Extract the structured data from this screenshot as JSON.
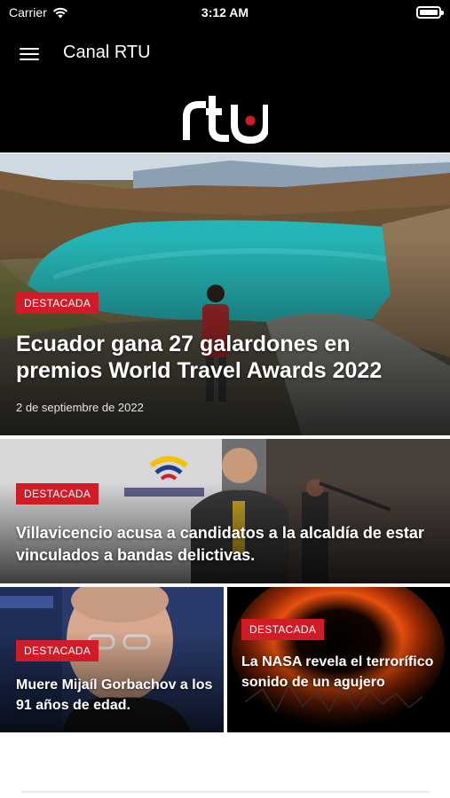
{
  "status_bar": {
    "carrier": "Carrier",
    "time": "3:12 AM"
  },
  "app_bar": {
    "title": "Canal RTU"
  },
  "logo": {
    "text": "rtu",
    "accent_color": "#d01c26"
  },
  "articles": [
    {
      "badge": "DESTACADA",
      "title": "Ecuador gana 27 galardones en premios World Travel Awards 2022",
      "date": "2 de septiembre de 2022"
    },
    {
      "badge": "DESTACADA",
      "title": "Villavicencio acusa a candidatos a la alcaldía de estar vinculados a bandas delictivas."
    },
    {
      "badge": "DESTACADA",
      "title": "Muere Mijaíl Gorbachov a los 91 años de edad."
    },
    {
      "badge": "DESTACADA",
      "title": "La NASA revela el terrorífico sonido de un agujero"
    }
  ],
  "images": {
    "card1": "photo of a turquoise crater lake with a hiker on a path",
    "card2": "photo of a man in a suit speaking at a podium with microphones",
    "card3": "photo of an elderly man with glasses",
    "card4": "image of a black hole with glowing orange ring"
  },
  "colors": {
    "background": "#000000",
    "badge": "#d01c26",
    "text": "#ffffff"
  }
}
